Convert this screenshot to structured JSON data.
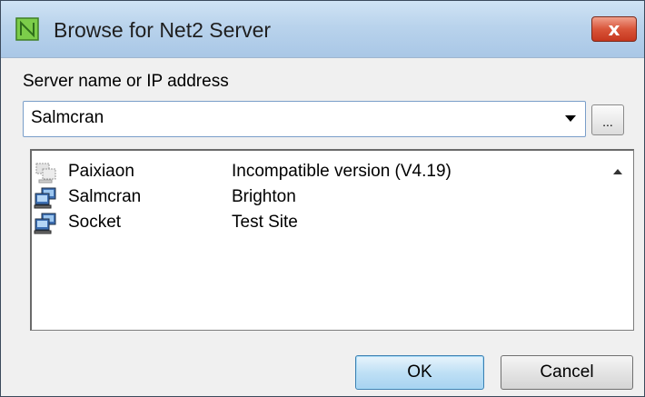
{
  "window": {
    "title": "Browse for Net2 Server",
    "close_label": "x"
  },
  "server_field": {
    "label": "Server name or IP address",
    "value": "Salmcran",
    "browse_label": "..."
  },
  "servers": [
    {
      "name": "Paixiaon",
      "description": "Incompatible version (V4.19)",
      "icon": "server-incompatible-icon"
    },
    {
      "name": "Salmcran",
      "description": "Brighton",
      "icon": "server-icon"
    },
    {
      "name": "Socket",
      "description": "Test Site",
      "icon": "server-icon"
    }
  ],
  "buttons": {
    "ok": "OK",
    "cancel": "Cancel"
  },
  "colors": {
    "titlebar": "#b9d3ec",
    "close": "#d9553a",
    "ok_button": "#bfe0f5"
  }
}
